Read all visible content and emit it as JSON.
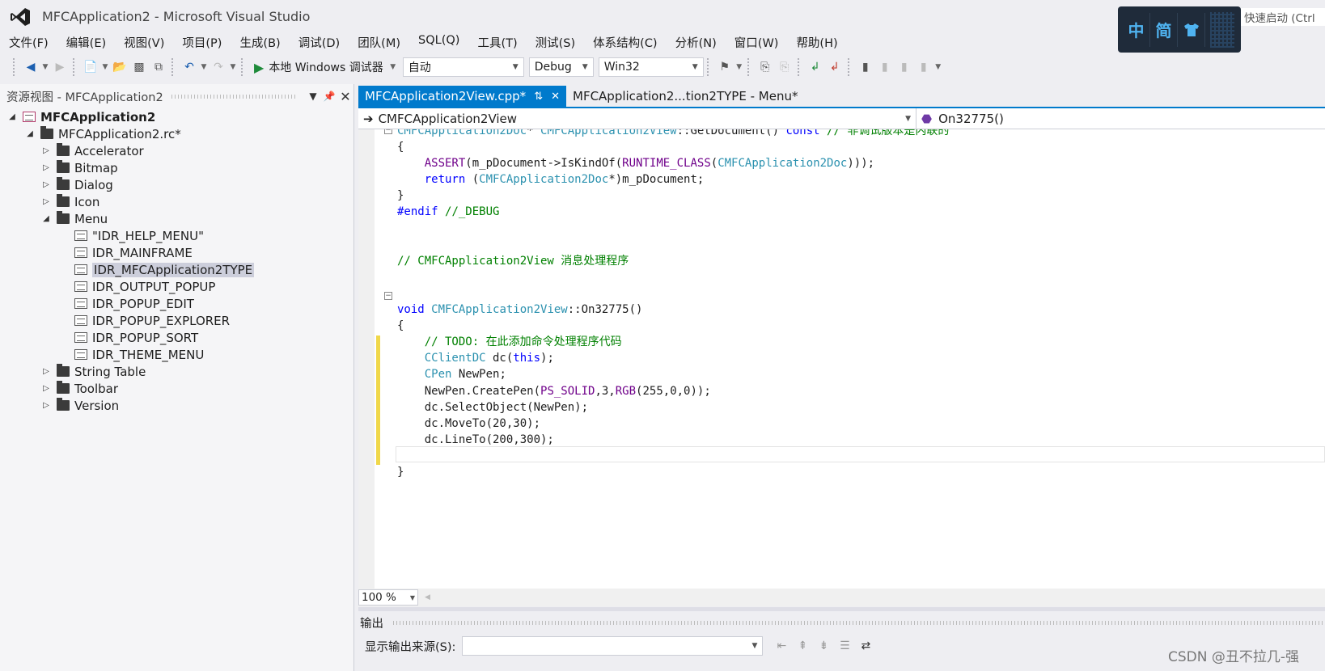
{
  "window": {
    "title": "MFCApplication2 - Microsoft Visual Studio",
    "quick_launch": "快速启动 (Ctrl"
  },
  "ime": {
    "lang": "中",
    "mode": "简",
    "skin_icon": "shirt-icon"
  },
  "menubar": [
    "文件(F)",
    "编辑(E)",
    "视图(V)",
    "项目(P)",
    "生成(B)",
    "调试(D)",
    "团队(M)",
    "SQL(Q)",
    "工具(T)",
    "测试(S)",
    "体系结构(C)",
    "分析(N)",
    "窗口(W)",
    "帮助(H)"
  ],
  "toolbar": {
    "debugger": "本地 Windows 调试器",
    "mode": "自动",
    "config": "Debug",
    "platform": "Win32"
  },
  "resource_view": {
    "title": "资源视图 - MFCApplication2",
    "root": "MFCApplication2",
    "rc": "MFCApplication2.rc*",
    "folders": [
      "Accelerator",
      "Bitmap",
      "Dialog",
      "Icon",
      "Menu"
    ],
    "menu_items": [
      "\"IDR_HELP_MENU\"",
      "IDR_MAINFRAME",
      "IDR_MFCApplication2TYPE",
      "IDR_OUTPUT_POPUP",
      "IDR_POPUP_EDIT",
      "IDR_POPUP_EXPLORER",
      "IDR_POPUP_SORT",
      "IDR_THEME_MENU"
    ],
    "folders_after": [
      "String Table",
      "Toolbar",
      "Version"
    ],
    "selected": "IDR_MFCApplication2TYPE"
  },
  "tabs": [
    {
      "label": "MFCApplication2View.cpp*",
      "active": true
    },
    {
      "label": "MFCApplication2...tion2TYPE - Menu*",
      "active": false
    }
  ],
  "nav": {
    "class": "CMFCApplication2View",
    "member": "On32775()"
  },
  "editor": {
    "zoom": "100 %"
  },
  "output": {
    "title": "输出",
    "source_label": "显示输出来源(S):",
    "source_value": ""
  },
  "watermark": "CSDN @丑不拉几-强",
  "colors": {
    "accent": "#007acc",
    "keyword": "#0000ff",
    "type": "#2b91af",
    "comment": "#008000",
    "macro": "#6f008a",
    "change_margin": "#f0d84a"
  }
}
